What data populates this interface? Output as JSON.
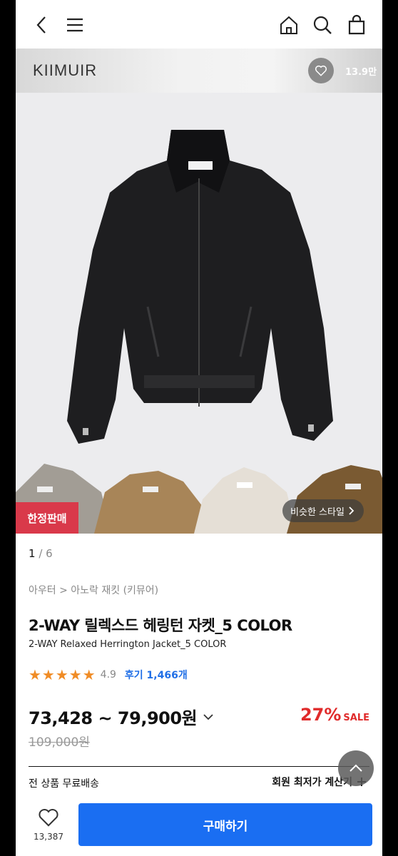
{
  "nav": {
    "back_icon": "chevron-left-icon",
    "menu_icon": "hamburger-icon",
    "home_icon": "home-icon",
    "search_icon": "search-icon",
    "cart_icon": "shopping-bag-icon"
  },
  "brand": {
    "name": "KIIMUIR",
    "likes": "13.9만"
  },
  "gallery": {
    "limited_badge": "한정판매",
    "similar_style": "비슷한 스타일",
    "current": "1",
    "separator": " / ",
    "total": "6"
  },
  "product": {
    "breadcrumb": "아우터 > 아노락 재킷 (키뮤어)",
    "title": "2-WAY 릴렉스드 헤링턴 자켓_5 COLOR",
    "subtitle": "2-WAY Relaxed Herrington Jacket_5 COLOR",
    "stars": "★★★★★",
    "rating": "4.9",
    "reviews": "후기 1,466개",
    "price": "73,428 ~ 79,900원",
    "discount": "27%",
    "sale_label": "SALE",
    "original_price": "109,000원",
    "shipping": "전 상품 무료배송",
    "member_price": "회원 최저가 계산기"
  },
  "bottom": {
    "wish_count": "13,387",
    "buy_label": "구매하기"
  },
  "colors": {
    "buy": "#1a6ef2",
    "discount": "#e02b2b",
    "badge": "#d9394a",
    "stars": "#f08c26",
    "review_link": "#1f6ee6"
  }
}
